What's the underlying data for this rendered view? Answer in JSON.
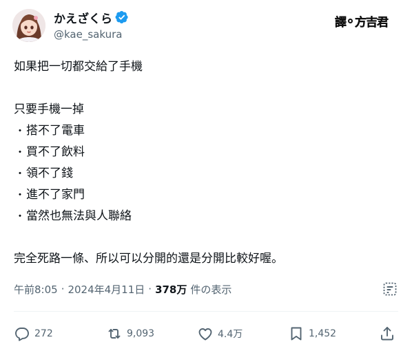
{
  "author": {
    "display_name": "かえざくら",
    "handle": "@kae_sakura",
    "verified_color": "#1d9bf0"
  },
  "watermark": {
    "left": "譯",
    "right": "方吉君"
  },
  "tweet": {
    "line1": "如果把一切都交給了手機",
    "line2": "只要手機一掉",
    "bullet_char": "・",
    "bullets": [
      "搭不了電車",
      "買不了飲料",
      "領不了錢",
      "進不了家門",
      "當然也無法與人聯絡"
    ],
    "line3": "完全死路一條、所以可以分開的還是分開比較好喔。"
  },
  "meta": {
    "time": "午前8:05",
    "separator": "·",
    "date": "2024年4月11日",
    "views_count": "378万",
    "views_label": "件の表示"
  },
  "actions": {
    "replies": "272",
    "reposts": "9,093",
    "likes": "4.4万",
    "bookmarks": "1,452"
  },
  "colors": {
    "text": "#0f1419",
    "secondary": "#536471",
    "accent": "#1d9bf0"
  }
}
